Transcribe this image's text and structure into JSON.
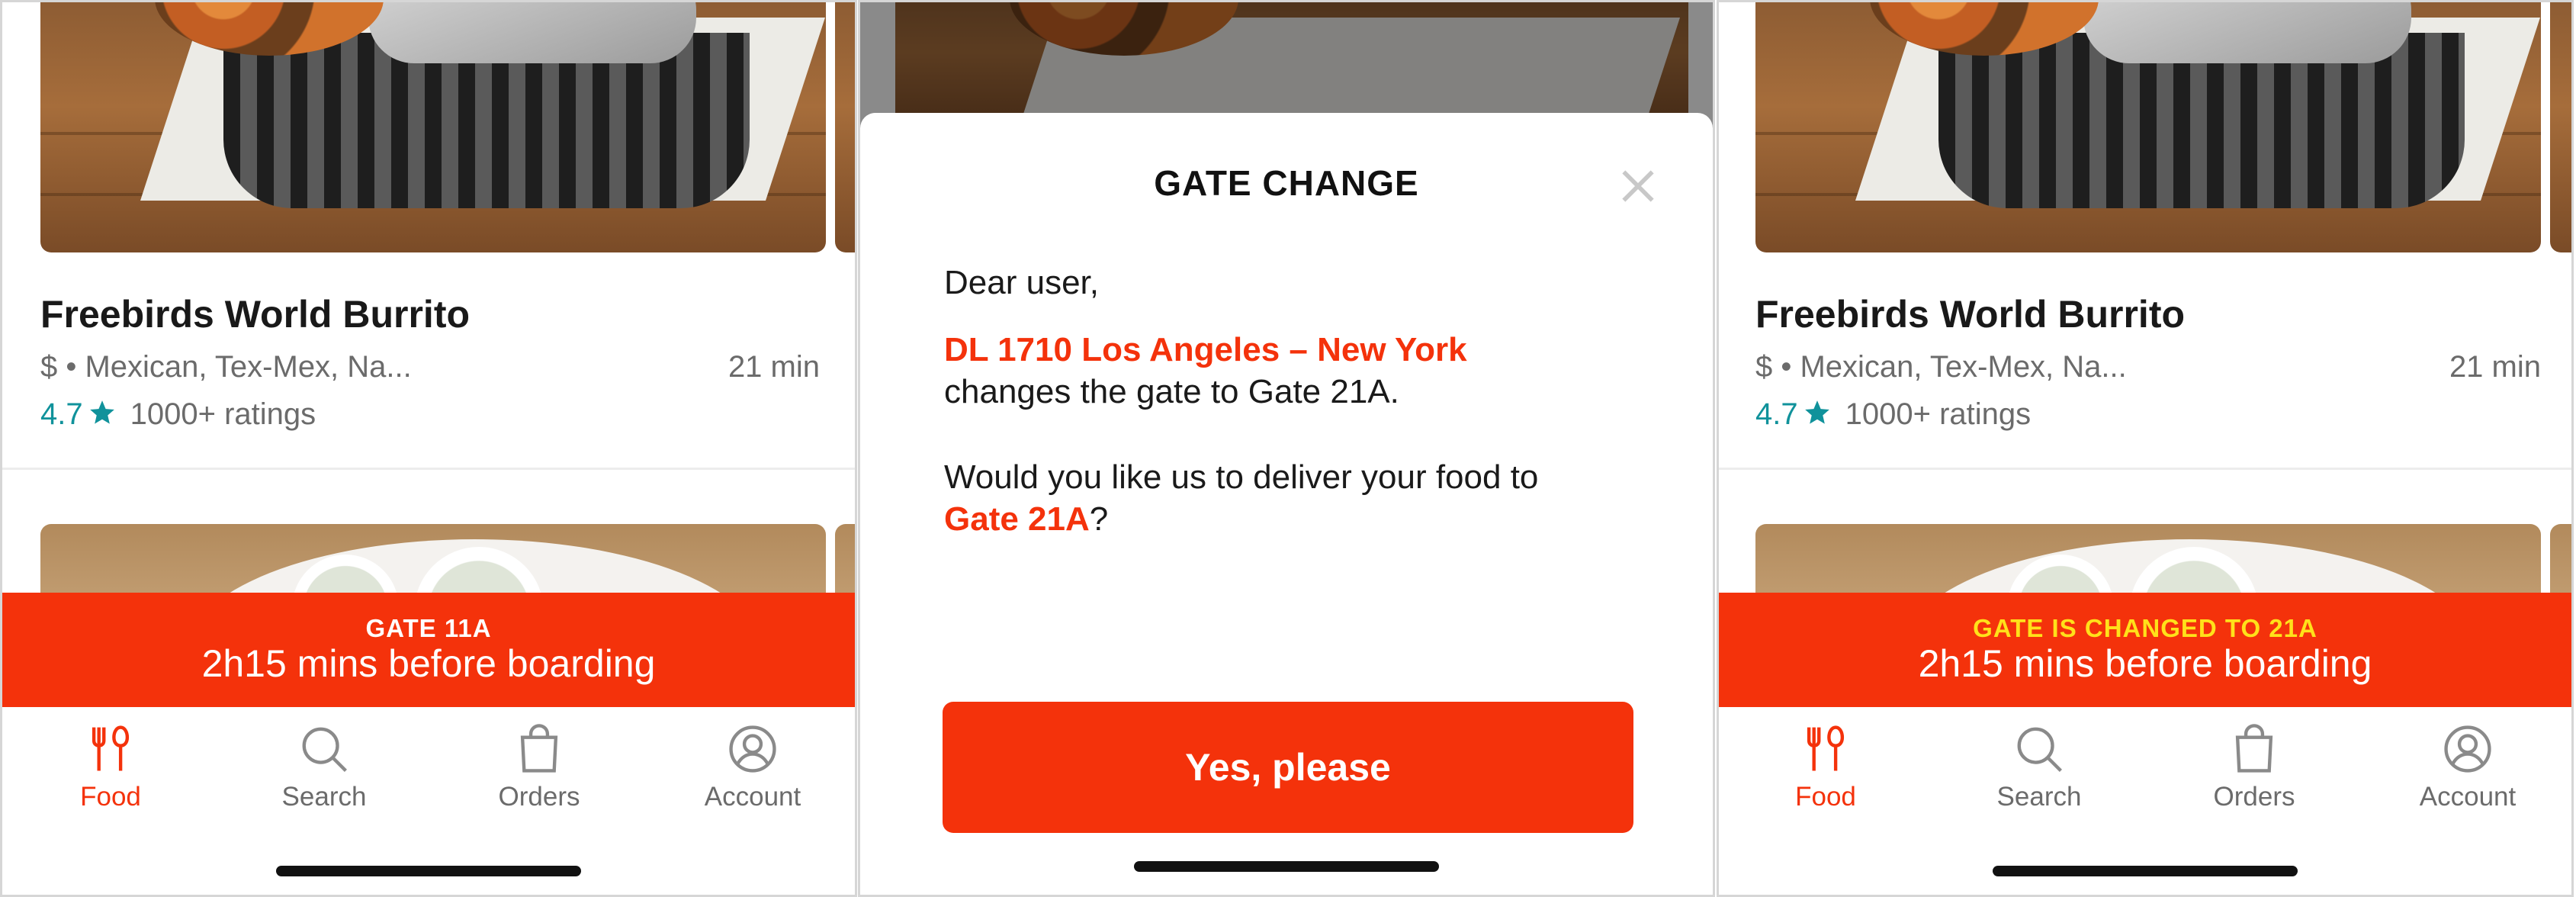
{
  "restaurant": {
    "name": "Freebirds World Burrito",
    "meta": "$ • Mexican, Tex-Mex, Na...",
    "delivery_time": "21 min",
    "rating": "4.7",
    "ratings_count": "1000+ ratings"
  },
  "banner_before": {
    "gate_label": "GATE 11A",
    "countdown": "2h15 mins before boarding"
  },
  "banner_after": {
    "gate_label": "GATE IS CHANGED TO 21A",
    "countdown": "2h15 mins before boarding"
  },
  "tabs": [
    {
      "label": "Food",
      "icon": "fork-spoon-icon",
      "active": true
    },
    {
      "label": "Search",
      "icon": "search-icon",
      "active": false
    },
    {
      "label": "Orders",
      "icon": "shopping-bag-icon",
      "active": false
    },
    {
      "label": "Account",
      "icon": "user-circle-icon",
      "active": false
    }
  ],
  "modal": {
    "title": "GATE CHANGE",
    "greeting": "Dear user,",
    "flight": "DL 1710 Los Angeles – New York",
    "gate_change_text": "changes the gate to Gate 21A.",
    "question": "Would you like us to deliver your food to",
    "new_gate": "Gate 21A",
    "question_end": "?",
    "confirm_label": "Yes, please"
  },
  "colors": {
    "accent": "#f4320b",
    "rating": "#10929b",
    "banner_highlight": "#ffe11a"
  }
}
